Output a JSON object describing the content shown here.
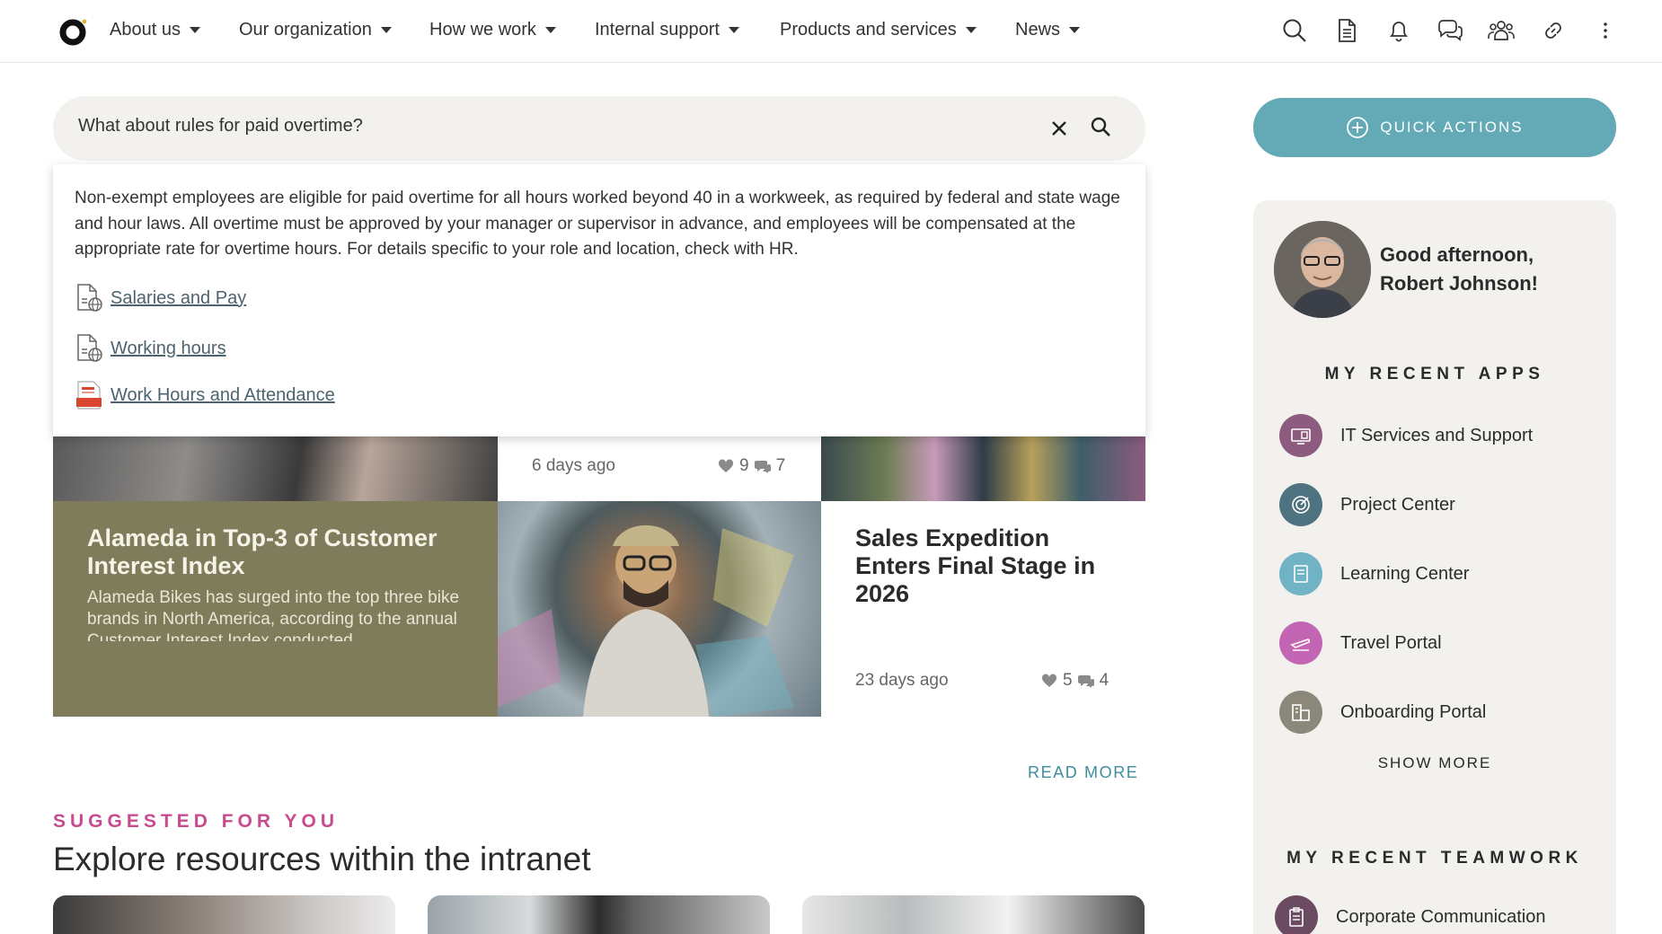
{
  "nav": {
    "items": [
      {
        "label": "About us"
      },
      {
        "label": "Our organization"
      },
      {
        "label": "How we work"
      },
      {
        "label": "Internal support"
      },
      {
        "label": "Products and services"
      },
      {
        "label": "News"
      }
    ],
    "icons": [
      "search-icon",
      "document-icon",
      "bell-icon",
      "chat-icon",
      "people-icon",
      "link-icon",
      "more-vertical-icon"
    ]
  },
  "search": {
    "value": "What about rules for paid overtime?",
    "answer": "Non-exempt employees are eligible for paid overtime for all hours worked beyond 40 in a workweek, as required by federal and state wage and hour laws. All overtime must be approved by your manager or supervisor in advance, and employees will be compensated at the appropriate rate for overtime hours. For details specific to your role and location, check with HR.",
    "sources": [
      {
        "label": "Salaries and Pay",
        "icon": "web-page-icon"
      },
      {
        "label": "Working hours",
        "icon": "web-page-icon"
      },
      {
        "label": "Work Hours and Attendance",
        "icon": "pdf-document-icon"
      }
    ]
  },
  "news": {
    "top_mid": {
      "ago": "6 days ago",
      "likes": "9",
      "comments": "7"
    },
    "olive": {
      "title": "Alameda in Top-3 of Customer Interest Index",
      "excerpt": "Alameda Bikes has surged into the top three bike brands in North America, according to the annual Customer Interest Index conducted"
    },
    "right": {
      "title": "Sales Expedition Enters Final Stage in 2026",
      "ago": "23 days ago",
      "likes": "5",
      "comments": "4"
    },
    "read_more": "READ MORE"
  },
  "suggested": {
    "label": "SUGGESTED FOR YOU",
    "title": "Explore resources within the intranet"
  },
  "side": {
    "quick_actions": "QUICK ACTIONS",
    "greeting": "Good afternoon, Robert Johnson!",
    "recent_apps_title": "MY RECENT APPS",
    "apps": [
      {
        "label": "IT Services and Support",
        "icon": "computer-icon",
        "color": "#8c5b7e"
      },
      {
        "label": "Project Center",
        "icon": "target-icon",
        "color": "#4f7280"
      },
      {
        "label": "Learning Center",
        "icon": "book-icon",
        "color": "#6fb3c4"
      },
      {
        "label": "Travel Portal",
        "icon": "plane-icon",
        "color": "#c465b4"
      },
      {
        "label": "Onboarding Portal",
        "icon": "building-icon",
        "color": "#8b877a"
      }
    ],
    "show_more": "SHOW MORE",
    "recent_teamwork_title": "MY RECENT TEAMWORK",
    "teamwork": [
      {
        "label": "Corporate Communication",
        "icon": "clipboard-icon",
        "color": "#6a4b62"
      }
    ]
  },
  "colors": {
    "accent_teal": "#64a9b6",
    "accent_pink": "#c84b8e",
    "olive": "#7f7c5b"
  }
}
